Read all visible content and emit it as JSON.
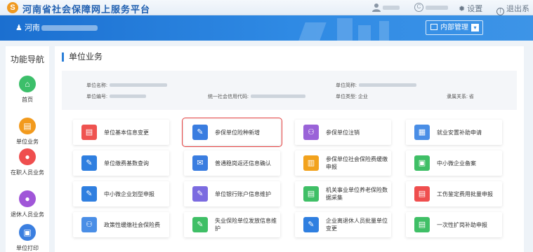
{
  "header": {
    "site_title": "河南省社会保障网上服务平台",
    "logo_glyph": "S",
    "settings_label": "设置",
    "logout_label": "退出系统"
  },
  "banner": {
    "user_prefix": "河南",
    "mgmt_label": "内部管理",
    "mgmt_dropdown_glyph": "▾"
  },
  "sidebar": {
    "title": "功能导航",
    "items": [
      {
        "label": "首页",
        "glyph": "⌂",
        "color": "#3cbf6a"
      },
      {
        "label": "单位业务",
        "glyph": "▤",
        "color": "#f29a1d"
      },
      {
        "label": "在职人员业务",
        "glyph": "●",
        "color": "#ef4e4e"
      },
      {
        "label": "退休人员业务",
        "glyph": "●",
        "color": "#a056d8"
      },
      {
        "label": "单位打印",
        "glyph": "▣",
        "color": "#3b7fe0"
      }
    ]
  },
  "main": {
    "title": "单位业务",
    "info": {
      "unit_name_label": "单位名称:",
      "unit_code_label": "单位编号:",
      "credit_code_label": "统一社会信用代码:",
      "short_name_label": "单位简称:",
      "unit_type_label": "单位类型:",
      "unit_type_value": "企业",
      "affiliation_label": "隶属关系:",
      "affiliation_value": "省"
    },
    "cards": [
      {
        "label": "单位基本信息变更",
        "glyph": "▤",
        "color": "#ef5350"
      },
      {
        "label": "参保单位险种新增",
        "glyph": "✎",
        "color": "#3a7de0",
        "selected": true
      },
      {
        "label": "参保单位注销",
        "glyph": "⚇",
        "color": "#9a63d8"
      },
      {
        "label": "就业安置补助申请",
        "glyph": "▦",
        "color": "#4a8ee6"
      },
      {
        "label": "单位缴费基数查询",
        "glyph": "✎",
        "color": "#2f7fe0"
      },
      {
        "label": "普通稳岗返还信息确认",
        "glyph": "✉",
        "color": "#3a7de0"
      },
      {
        "label": "参保单位社会保险费缓缴申报",
        "glyph": "▥",
        "color": "#f2a21d"
      },
      {
        "label": "中小微企业备案",
        "glyph": "▣",
        "color": "#3fbf66"
      },
      {
        "label": "中小微企业划型申报",
        "glyph": "✎",
        "color": "#2f7fe0"
      },
      {
        "label": "单位银行账户信息维护",
        "glyph": "✎",
        "color": "#7b6be0"
      },
      {
        "label": "机关事业单位养老保险数据采集",
        "glyph": "▤",
        "color": "#3fbf66"
      },
      {
        "label": "工伤鉴定费用批量申报",
        "glyph": "▤",
        "color": "#ef4e4e"
      },
      {
        "label": "政策性缓缴社会保险费",
        "glyph": "⚇",
        "color": "#4a8ee6"
      },
      {
        "label": "失业保险单位发放信息维护",
        "glyph": "✎",
        "color": "#3fbf66"
      },
      {
        "label": "企业离退休人员批量单位变更",
        "glyph": "✎",
        "color": "#2f7fe0"
      },
      {
        "label": "一次性扩岗补助申报",
        "glyph": "▤",
        "color": "#3fbf66"
      }
    ]
  }
}
